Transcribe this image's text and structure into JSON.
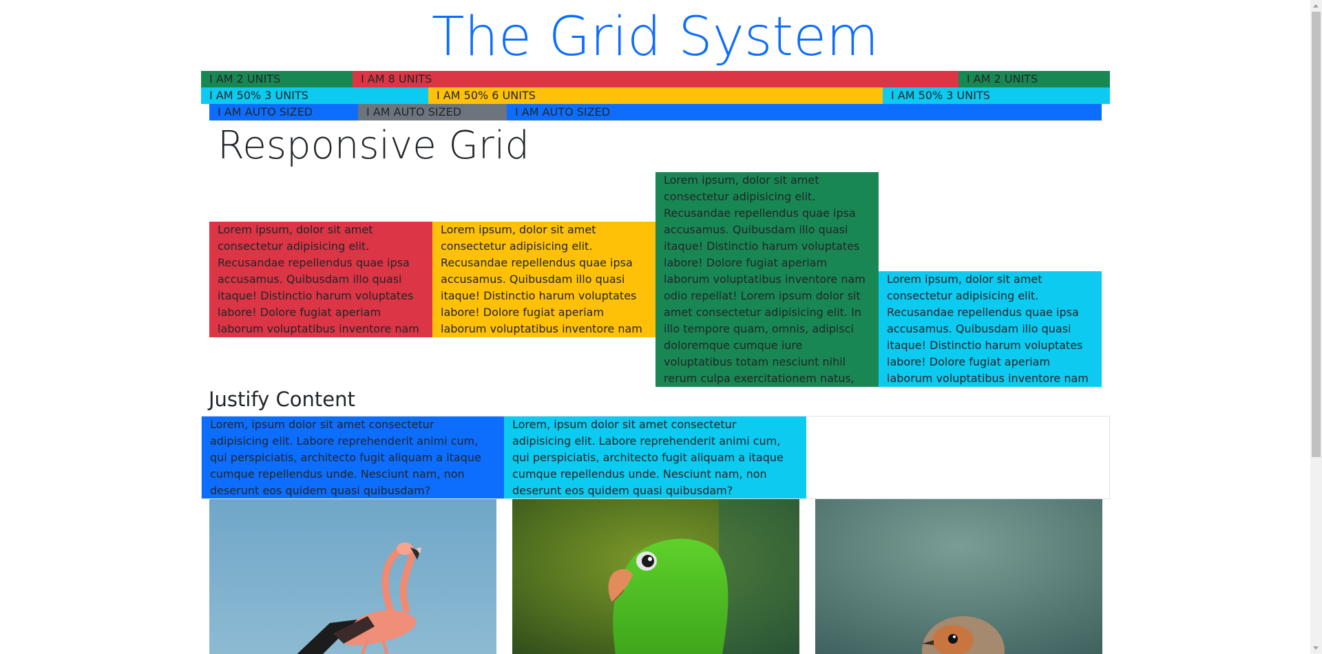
{
  "header": {
    "title": "The Grid System"
  },
  "units_row": {
    "two_left": "I AM 2 UNITS",
    "eight": "I AM 8 UNITS",
    "two_right": "I AM 2 UNITS"
  },
  "percent_row": {
    "left": "I AM 50% 3 UNITS",
    "middle": "I AM 50% 6 UNITS",
    "right": "I AM 50% 3 UNITS"
  },
  "auto_row": {
    "first": "I AM AUTO SIZED",
    "second": "I AM AUTO SIZED",
    "third": "I AM AUTO SIZED"
  },
  "responsive": {
    "heading": "Responsive Grid",
    "cards": [
      "Lorem ipsum, dolor sit amet consectetur adipisicing elit. Recusandae repellendus quae ipsa accusamus. Quibusdam illo quasi itaque! Distinctio harum voluptates labore! Dolore fugiat aperiam laborum voluptatibus inventore nam odio repellat!",
      "Lorem ipsum, dolor sit amet consectetur adipisicing elit. Recusandae repellendus quae ipsa accusamus. Quibusdam illo quasi itaque! Distinctio harum voluptates labore! Dolore fugiat aperiam laborum voluptatibus inventore nam odio repellat!",
      "Lorem ipsum, dolor sit amet consectetur adipisicing elit. Recusandae repellendus quae ipsa accusamus. Quibusdam illo quasi itaque! Distinctio harum voluptates labore! Dolore fugiat aperiam laborum voluptatibus inventore nam odio repellat! Lorem ipsum dolor sit amet consectetur adipisicing elit. In illo tempore quam, omnis, adipisci doloremque cumque iure voluptatibus totam nesciunt nihil rerum culpa exercitationem natus, laborum odio aliquid explicabo ullam.",
      "Lorem ipsum, dolor sit amet consectetur adipisicing elit. Recusandae repellendus quae ipsa accusamus. Quibusdam illo quasi itaque! Distinctio harum voluptates labore! Dolore fugiat aperiam laborum voluptatibus inventore nam odio repellat!"
    ]
  },
  "justify": {
    "heading": "Justify Content",
    "cards": [
      "Lorem, ipsum dolor sit amet consectetur adipisicing elit. Labore reprehenderit animi cum, qui perspiciatis, architecto fugit aliquam a itaque cumque repellendus unde. Nesciunt nam, non deserunt eos quidem quasi quibusdam?",
      "Lorem, ipsum dolor sit amet consectetur adipisicing elit. Labore reprehenderit animi cum, qui perspiciatis, architecto fugit aliquam a itaque cumque repellendus unde. Nesciunt nam, non deserunt eos quidem quasi quibusdam?"
    ]
  },
  "photos": [
    "flamingo",
    "green-parrot",
    "robin"
  ],
  "colors": {
    "primary": "#0d6efd",
    "success": "#198754",
    "danger": "#dc3545",
    "warning": "#ffc107",
    "info": "#0dcaf0",
    "secondary": "#6c757d"
  }
}
